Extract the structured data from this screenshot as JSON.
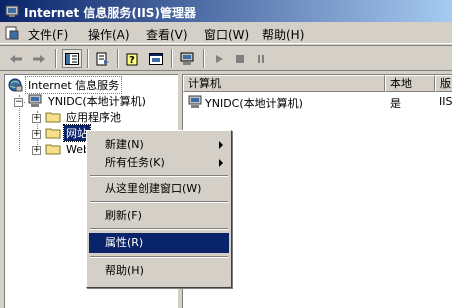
{
  "window": {
    "title": "Internet 信息服务(IIS)管理器"
  },
  "menu": {
    "items": [
      {
        "label": "文件(F)"
      },
      {
        "label": "操作(A)"
      },
      {
        "label": "查看(V)"
      },
      {
        "label": "窗口(W)"
      },
      {
        "label": "帮助(H)"
      }
    ]
  },
  "toolbar": {
    "buttons": [
      "back-icon",
      "forward-icon",
      "show-tree-icon",
      "export-list-icon",
      "help-icon",
      "properties-icon",
      "computer-icon",
      "play-icon",
      "stop-icon",
      "pause-icon"
    ]
  },
  "tree": {
    "root": "Internet 信息服务",
    "computer": "YNIDC(本地计算机)",
    "app_pools": "应用程序池",
    "websites": "网站",
    "web_ext": "Web"
  },
  "list": {
    "columns": [
      "计算机",
      "本地",
      "版"
    ],
    "rows": [
      {
        "name": "YNIDC(本地计算机)",
        "local": "是",
        "version": "IIS"
      }
    ]
  },
  "context_menu": {
    "new": "新建(N)",
    "all_tasks": "所有任务(K)",
    "new_window": "从这里创建窗口(W)",
    "refresh": "刷新(F)",
    "properties": "属性(R)",
    "help": "帮助(H)"
  },
  "colors": {
    "titlebar_start": "#0a246a",
    "titlebar_end": "#a6caf0",
    "selection": "#0a246a",
    "chrome": "#d4d0c8"
  }
}
